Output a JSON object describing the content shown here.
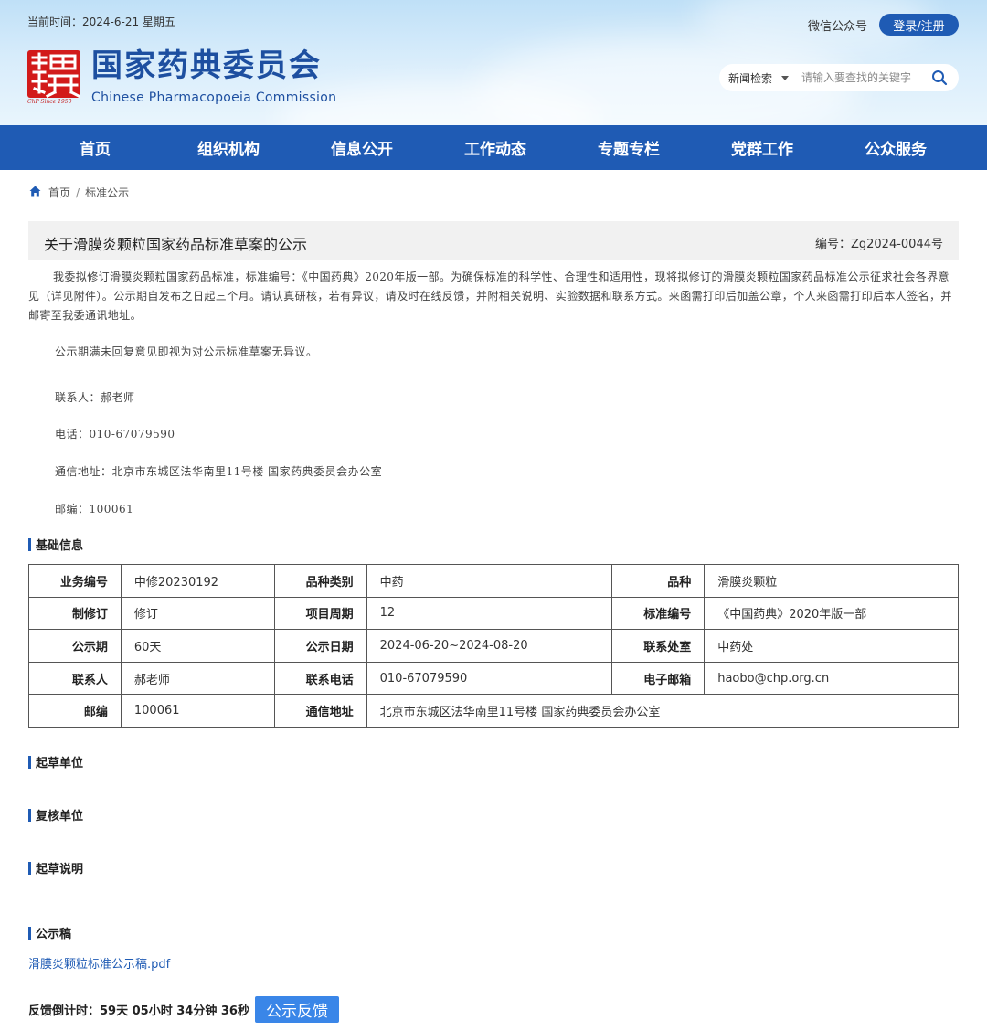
{
  "header": {
    "current_time": "当前时间：2024-6-21 星期五",
    "logo_since": "ChP Since 1950",
    "site_title": "国家药典委员会",
    "site_subtitle": "Chinese Pharmacopoeia Commission",
    "wechat_label": "微信公众号",
    "login_label": "登录/注册",
    "search": {
      "category": "新闻检索",
      "placeholder": "请输入要查找的关键字"
    }
  },
  "nav": {
    "items": [
      "首页",
      "组织机构",
      "信息公开",
      "工作动态",
      "专题专栏",
      "党群工作",
      "公众服务"
    ]
  },
  "breadcrumb": {
    "home": "首页",
    "separator": "/",
    "current": "标准公示"
  },
  "article": {
    "title": "关于滑膜炎颗粒国家药品标准草案的公示",
    "code": "编号：Zg2024-0044号",
    "paragraph": "我委拟修订滑膜炎颗粒国家药品标准，标准编号：《中国药典》2020年版一部。为确保标准的科学性、合理性和适用性，现将拟修订的滑膜炎颗粒国家药品标准公示征求社会各界意见（详见附件）。公示期自发布之日起三个月。请认真研核，若有异议，请及时在线反馈，并附相关说明、实验数据和联系方式。来函需打印后加盖公章，个人来函需打印后本人签名，并邮寄至我委通讯地址。",
    "note": "公示期满未回复意见即视为对公示标准草案无异议。",
    "contact_person": "联系人：郝老师",
    "phone": "电话：010-67079590",
    "address": "通信地址：北京市东城区法华南里11号楼  国家药典委员会办公室",
    "postcode": "邮编：100061"
  },
  "sections": {
    "basic_info": "基础信息",
    "drafting_unit": "起草单位",
    "review_unit": "复核单位",
    "drafting_notes": "起草说明",
    "draft": "公示稿"
  },
  "table": {
    "rows": [
      [
        {
          "label": "业务编号",
          "value": "中修20230192"
        },
        {
          "label": "品种类别",
          "value": "中药"
        },
        {
          "label": "品种",
          "value": "滑膜炎颗粒"
        }
      ],
      [
        {
          "label": "制修订",
          "value": "修订"
        },
        {
          "label": "项目周期",
          "value": "12"
        },
        {
          "label": "标准编号",
          "value": "《中国药典》2020年版一部"
        }
      ],
      [
        {
          "label": "公示期",
          "value": "60天"
        },
        {
          "label": "公示日期",
          "value": "2024-06-20~2024-08-20"
        },
        {
          "label": "联系处室",
          "value": "中药处"
        }
      ],
      [
        {
          "label": "联系人",
          "value": "郝老师"
        },
        {
          "label": "联系电话",
          "value": "010-67079590"
        },
        {
          "label": "电子邮箱",
          "value": "haobo@chp.org.cn"
        }
      ],
      [
        {
          "label": "邮编",
          "value": "100061"
        },
        {
          "label": "通信地址",
          "value": "北京市东城区法华南里11号楼 国家药典委员会办公室"
        }
      ]
    ]
  },
  "attachment": {
    "pdf_name": "滑膜炎颗粒标准公示稿.pdf"
  },
  "feedback": {
    "countdown": "反馈倒计时：59天 05小时 34分钟 36秒",
    "button_label": "公示反馈"
  },
  "colors": {
    "brand_blue": "#1f5bb4",
    "seal_red": "#d21a1a",
    "feedback_blue": "#3a86e8"
  }
}
